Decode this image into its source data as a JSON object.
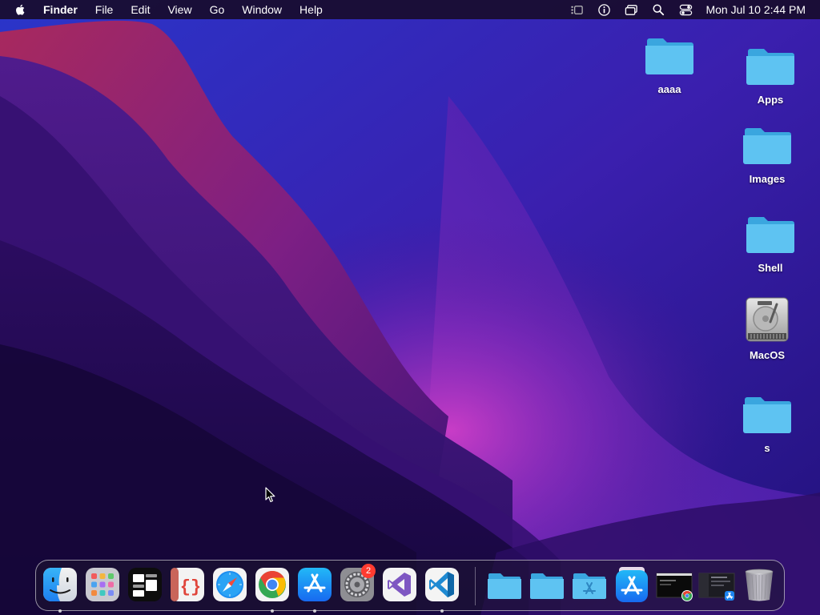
{
  "menubar": {
    "app_name": "Finder",
    "menus": [
      "File",
      "Edit",
      "View",
      "Go",
      "Window",
      "Help"
    ],
    "clock": "Mon Jul 10  2:44 PM"
  },
  "desktop": {
    "icons": [
      {
        "label": "aaaa",
        "type": "folder"
      },
      {
        "label": "Apps",
        "type": "folder"
      },
      {
        "label": "Images",
        "type": "folder"
      },
      {
        "label": "Shell",
        "type": "folder"
      },
      {
        "label": "MacOS",
        "type": "hard-drive"
      },
      {
        "label": "s",
        "type": "folder"
      }
    ]
  },
  "dock": {
    "apps": [
      {
        "name": "finder-icon",
        "running": true
      },
      {
        "name": "launchpad-icon",
        "running": false
      },
      {
        "name": "window-manager-icon",
        "running": false
      },
      {
        "name": "code-editor-icon",
        "running": false
      },
      {
        "name": "safari-icon",
        "running": false
      },
      {
        "name": "chrome-icon",
        "running": true
      },
      {
        "name": "app-store-icon",
        "running": true
      },
      {
        "name": "system-settings-icon",
        "running": false,
        "badge": "2"
      },
      {
        "name": "visual-studio-icon",
        "running": false
      },
      {
        "name": "vscode-icon",
        "running": true
      }
    ],
    "stacks": [
      {
        "name": "folder-stack-icon"
      },
      {
        "name": "folder-stack-icon"
      },
      {
        "name": "applications-folder-icon"
      },
      {
        "name": "app-store-download-icon"
      },
      {
        "name": "chrome-window-thumbnail-icon"
      },
      {
        "name": "app-window-thumbnail-icon"
      },
      {
        "name": "trash-icon"
      }
    ]
  },
  "colors": {
    "folder_blue": "#5ec3f2",
    "folder_blue_dark": "#3aa6df",
    "menubar_bg": "#180c2c",
    "badge_red": "#ff3b30"
  }
}
